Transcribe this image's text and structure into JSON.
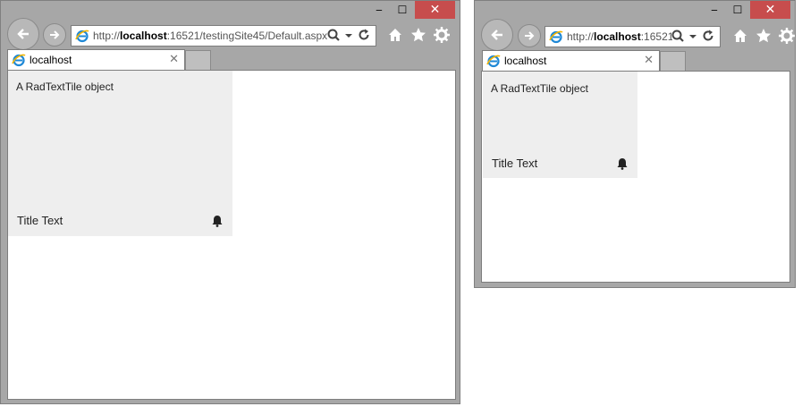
{
  "windows": [
    {
      "url_prefix": "http://",
      "url_host": "localhost",
      "url_rest": ":16521/testingSite45/Default.aspx",
      "tab_title": "localhost",
      "tile": {
        "body_text": "A RadTextTile object",
        "title_text": "Title Text"
      }
    },
    {
      "url_prefix": "http://",
      "url_host": "localhost",
      "url_rest": ":16521,",
      "tab_title": "localhost",
      "tile": {
        "body_text": "A RadTextTile object",
        "title_text": "Title Text"
      }
    }
  ],
  "caption": {
    "minimize": "‒",
    "maximize": "☐",
    "close": "✕"
  },
  "icons": [
    "back-arrow-icon",
    "forward-arrow-icon",
    "ie-logo-icon",
    "search-icon",
    "dropdown-icon",
    "refresh-icon",
    "home-icon",
    "favorites-star-icon",
    "settings-gear-icon",
    "close-tab-icon",
    "bell-icon"
  ],
  "colors": {
    "frame": "#a7a7a7",
    "close_button": "#c74d4d",
    "tile_background": "#eeeeee"
  }
}
